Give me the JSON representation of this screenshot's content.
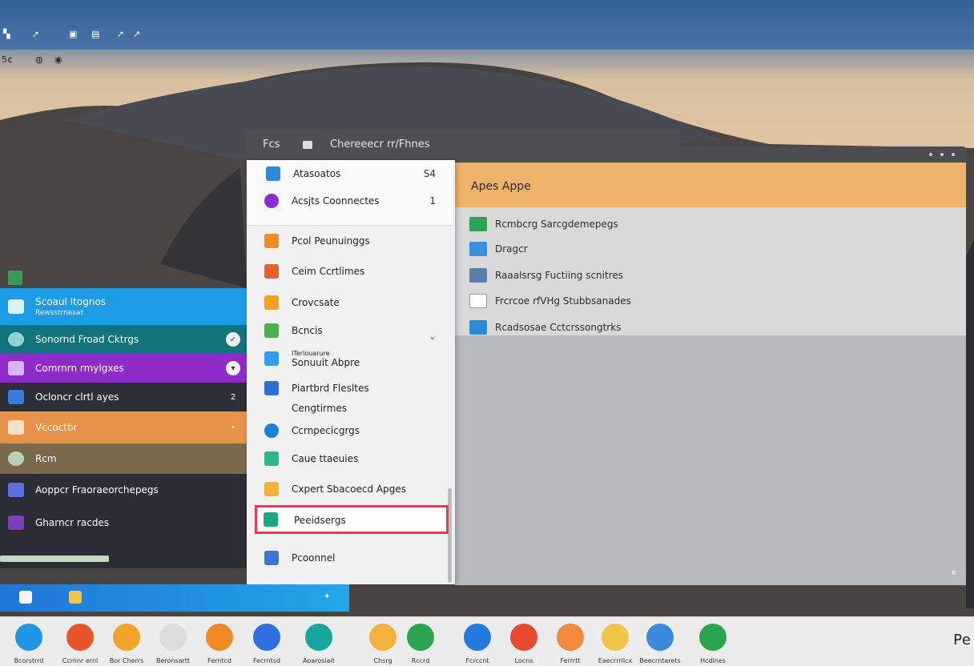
{
  "topbar": {
    "icons": [
      "menu-icon",
      "cursor-icon",
      "camera-icon",
      "monitor-icon",
      "pointer-icon",
      "share-icon"
    ]
  },
  "subbar": {
    "text": "5¢",
    "icons": [
      "wifi-icon",
      "settings-icon"
    ]
  },
  "dialog": {
    "title_left": "Fcs",
    "title": "Chereeecr rr/Fhnes",
    "menu_items": [
      {
        "label": "Atasoatos",
        "right": "S4",
        "color": "#2d8ad8"
      },
      {
        "label": "Acsjts Coonnectes",
        "right": "1",
        "color": "#8b2bd4"
      },
      {
        "label": "Pcol Peunuinggs",
        "right": "",
        "color": "#f28c28"
      },
      {
        "label": "Ceim Ccrtlimes",
        "right": "",
        "color": "#e0622d"
      },
      {
        "label": "Crovcsate",
        "right": "",
        "color": "#f4a21a"
      },
      {
        "label": "Bcncis",
        "right": "⌄",
        "color": "#4caf50"
      },
      {
        "label": "Sonuuit Abpre",
        "right": "",
        "color": "#2f9ef0",
        "sub": "ITerlouarure"
      },
      {
        "label": "Piartbrd Flesltes",
        "right": "",
        "color": "#2d6fd8"
      },
      {
        "label": "Cengtirmes",
        "right": "",
        "color": "transparent"
      },
      {
        "label": "Ccrnpecicgrgs",
        "right": "",
        "color": "#1b7fe0"
      },
      {
        "label": "Caue ttaeuies",
        "right": "",
        "color": "#2fb58d"
      },
      {
        "label": "Cxpert Sbacoecd Apges",
        "right": "",
        "color": "#f0b23a"
      },
      {
        "label": "Peeidsergs",
        "right": "",
        "color": "#19a882"
      },
      {
        "label": "Pcoonnel",
        "right": "",
        "color": "#3a78d6"
      }
    ],
    "content_title": "Apes Appe",
    "content_items": [
      {
        "label": "Rcmbcrg Sarcgdemepegs",
        "color": "#2aa44f"
      },
      {
        "label": "Dragcr",
        "color": "#3a8fe0"
      },
      {
        "label": "Raaalsrsg Fuctiing scnitres",
        "color": "#5b7fa8"
      },
      {
        "label": "Frcrcoe rfVHg Stubbsanades",
        "color": "#ffffff"
      },
      {
        "label": "Rcadsosae Cctcrssongtrks",
        "color": "#2d8ad8"
      }
    ],
    "corner_mark": "ĸ"
  },
  "left_panel": {
    "items": [
      {
        "label": "Scoaul Itognos",
        "sub": "Rewsstrnesat",
        "bg": "#1e9be6",
        "badge": ""
      },
      {
        "label": "Sonornd Froad Cktrgs",
        "bg": "#12737a",
        "badge": "✓"
      },
      {
        "label": "Comrnrn rmylgxes",
        "bg": "#8e2bc9",
        "badge": "▾"
      },
      {
        "label": "Ocloncr clrtl ayes",
        "bg": "#2c2f36",
        "badge": "2"
      },
      {
        "label": "Vccoctbr",
        "bg": "#e8934a",
        "badge": "•"
      },
      {
        "label": "Rcm",
        "bg": "#7a6a4c",
        "badge": ""
      },
      {
        "label": "Aoppcr Fraoraeorchepegs",
        "bg": "#2a2d33",
        "badge": ""
      },
      {
        "label": "Gharncr racdes",
        "bg": "#2a2d33",
        "badge": ""
      }
    ]
  },
  "dock": {
    "items": [
      {
        "label": "Bcorstrrd",
        "color": "#2296e6"
      },
      {
        "label": "Ccrnnr ernl",
        "color": "#e9542a"
      },
      {
        "label": "Bor Cherrs",
        "color": "#f2a52a"
      },
      {
        "label": "Beronsartt",
        "color": "#dcdcdc"
      },
      {
        "label": "Ferntcd",
        "color": "#f08a24"
      },
      {
        "label": "Fecrntsd",
        "color": "#2f6fe0"
      },
      {
        "label": "Aoarosiait",
        "color": "#1aa6a0"
      },
      {
        "label": "Chsrg",
        "color": "#f4b23c"
      },
      {
        "label": "Rccrd",
        "color": "#2aa44f"
      },
      {
        "label": "Fcrccnt",
        "color": "#2479e0"
      },
      {
        "label": "Locns",
        "color": "#e94a2f"
      },
      {
        "label": "Ferrrtt",
        "color": "#f08a3e"
      },
      {
        "label": "Eaecrrrllcx",
        "color": "#f2c44a"
      },
      {
        "label": "Beecrntarets",
        "color": "#3b8ae0"
      },
      {
        "label": "Hcdlnes",
        "color": "#2aa44f"
      }
    ],
    "tail": "Ре"
  }
}
